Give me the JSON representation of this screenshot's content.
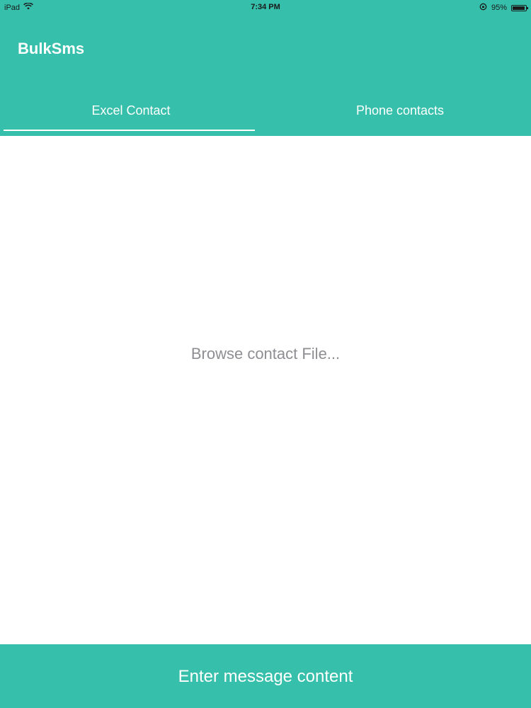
{
  "status_bar": {
    "device": "iPad",
    "time": "7:34 PM",
    "battery_percent": "95%",
    "battery_level": 0.95
  },
  "header": {
    "title": "BulkSms"
  },
  "tabs": [
    {
      "label": "Excel Contact",
      "selected": true
    },
    {
      "label": "Phone contacts",
      "selected": false
    }
  ],
  "main": {
    "browse_label": "Browse contact File..."
  },
  "footer": {
    "message_button_label": "Enter message content"
  },
  "colors": {
    "primary": "#36bfaa",
    "placeholder_text": "#8e8e93"
  }
}
